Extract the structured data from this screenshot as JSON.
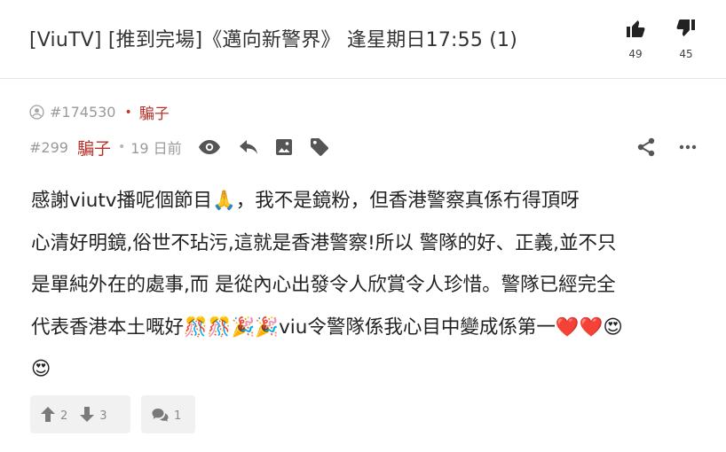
{
  "thread": {
    "title": "[ViuTV] [推到完場]《邁向新警界》 逢星期日17:55 (1)",
    "likes": "49",
    "dislikes": "45"
  },
  "reply_to": {
    "id": "#174530",
    "name": "騙子"
  },
  "post": {
    "floor": "#299",
    "author": "騙子",
    "separator": "•",
    "time": "19 日前",
    "lines": [
      "感謝viutv播呢個節目🙏，我不是鏡粉，但香港警察真係冇得頂呀",
      "心清好明鏡,俗世不玷污,這就是香港警察!所以 警隊的好、正義,並不只",
      "是單純外在的處事,而 是從內心出發令人欣賞令人珍惜。警隊已經完全",
      "代表香港本土嘅好🎊🎊🎉🎉viu令警隊係我心目中變成係第一❤️❤️😍",
      "😍"
    ]
  },
  "actions": {
    "upvotes": "2",
    "downvotes": "3",
    "quotes": "1"
  },
  "colors": {
    "accent_red": "#b8322a",
    "muted_gray": "#9a9a9a",
    "icon_gray": "#555555",
    "bar_bg": "#f1f1f1"
  }
}
